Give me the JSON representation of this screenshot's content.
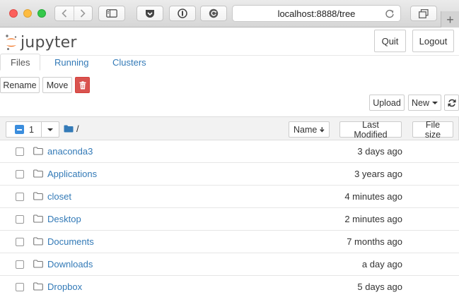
{
  "browser": {
    "url": "localhost:8888/tree"
  },
  "header": {
    "logo_text": "jupyter",
    "quit_label": "Quit",
    "logout_label": "Logout"
  },
  "tabs": [
    {
      "label": "Files",
      "active": true
    },
    {
      "label": "Running",
      "active": false
    },
    {
      "label": "Clusters",
      "active": false
    }
  ],
  "toolbar": {
    "rename_label": "Rename",
    "move_label": "Move",
    "upload_label": "Upload",
    "new_label": "New"
  },
  "list_header": {
    "selected_count": "1",
    "path": "/",
    "sort_name_label": "Name",
    "sort_modified_label": "Last Modified",
    "sort_size_label": "File size"
  },
  "files": [
    {
      "name": "anaconda3",
      "modified": "3 days ago"
    },
    {
      "name": "Applications",
      "modified": "3 years ago"
    },
    {
      "name": "closet",
      "modified": "4 minutes ago"
    },
    {
      "name": "Desktop",
      "modified": "2 minutes ago"
    },
    {
      "name": "Documents",
      "modified": "7 months ago"
    },
    {
      "name": "Downloads",
      "modified": "a day ago"
    },
    {
      "name": "Dropbox",
      "modified": "5 days ago"
    }
  ],
  "colors": {
    "link": "#337ab7",
    "delete": "#d9534f",
    "checkbox_selected": "#3b8ddd",
    "logo_orange": "#f37726"
  }
}
